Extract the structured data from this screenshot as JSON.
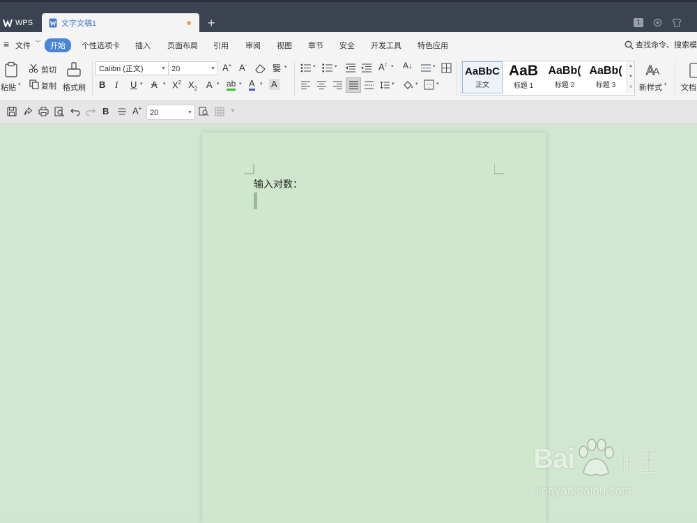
{
  "titlebar": {
    "app_label": "WPS",
    "doc_tab": "文字文稿1",
    "new_tab": "+",
    "badge": "1"
  },
  "menu": {
    "hamburger": "≡",
    "file": "文件",
    "items": [
      "开始",
      "个性选项卡",
      "插入",
      "页面布局",
      "引用",
      "审阅",
      "视图",
      "章节",
      "安全",
      "开发工具",
      "特色应用"
    ],
    "search": "查找命令、搜索模板"
  },
  "ribbon": {
    "paste": "粘贴",
    "cut": "剪切",
    "copy": "复制",
    "format_painter": "格式刷",
    "font_name": "Calibri (正文)",
    "font_size": "20",
    "styles": [
      {
        "sample": "AaBbC",
        "name": "正文"
      },
      {
        "sample": "AaB",
        "name": "标题 1"
      },
      {
        "sample": "AaBb(",
        "name": "标题 2"
      },
      {
        "sample": "AaBb(",
        "name": "标题 3"
      }
    ],
    "new_style": "新样式",
    "doc_assistant": "文档"
  },
  "quickbar": {
    "font_size": "20"
  },
  "document": {
    "text": "输入对数："
  },
  "watermark": {
    "main": "Bai",
    "sub": "jingyan.baidu.com"
  },
  "colors": {
    "titlebar": "#3c4350",
    "accent": "#4a86d8",
    "page": "#cfe8cd",
    "background": "#d2e7d1"
  }
}
